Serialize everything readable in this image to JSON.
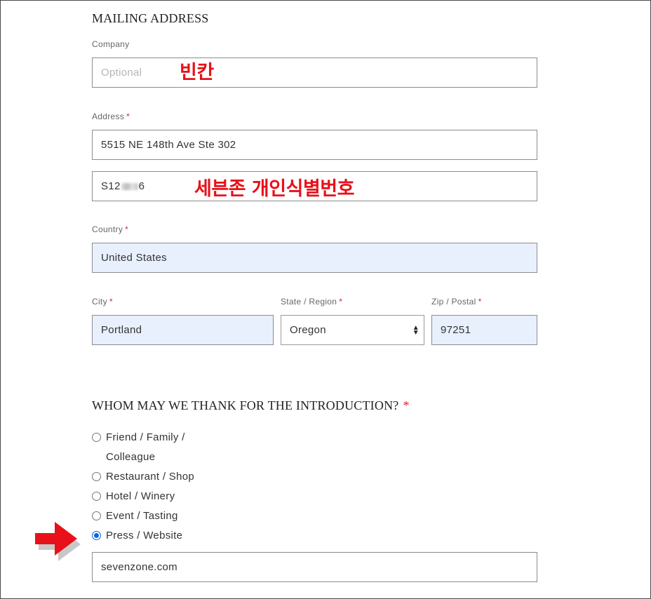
{
  "mailing": {
    "title": "MAILING ADDRESS",
    "company_label": "Company",
    "company_placeholder": "Optional",
    "company_annotation": "빈칸",
    "address_label": "Address",
    "address_line1": "5515 NE 148th Ave Ste 302",
    "address_line2_prefix": "S12",
    "address_line2_suffix": "6",
    "address_annotation": "세븐존 개인식별번호",
    "country_label": "Country",
    "country_value": "United States",
    "city_label": "City",
    "city_value": "Portland",
    "state_label": "State / Region",
    "state_value": "Oregon",
    "zip_label": "Zip / Postal",
    "zip_value": "97251",
    "required_mark": "*"
  },
  "thanks": {
    "title": "WHOM MAY WE THANK FOR THE INTRODUCTION?",
    "required_mark": "*",
    "options": [
      {
        "line1": "Friend / Family /",
        "line2": "Colleague",
        "checked": false
      },
      {
        "line1": "Restaurant / Shop",
        "checked": false
      },
      {
        "line1": "Hotel / Winery",
        "checked": false
      },
      {
        "line1": "Event / Tasting",
        "checked": false
      },
      {
        "line1": "Press / Website",
        "checked": true
      }
    ],
    "website_value": "sevenzone.com"
  },
  "colors": {
    "required": "#d8252b",
    "autofill_bg": "#e8f0fe",
    "annotation_red": "#e8101a",
    "radio_checked": "#0a66e0"
  },
  "icons": {
    "pointer_arrow": "red-arrow-icon",
    "select_arrows": "select-updown-icon"
  }
}
